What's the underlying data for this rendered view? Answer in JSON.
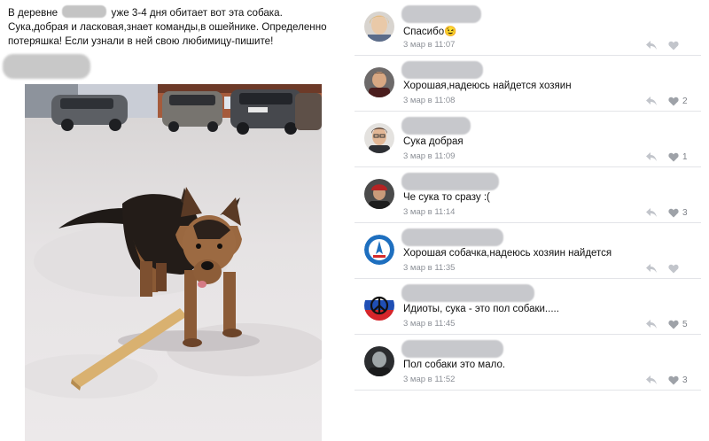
{
  "post": {
    "text_before": "В деревне",
    "text_after": "уже 3-4 дня обитает вот эта собака. Сука,добрая и ласковая,знает команды,в ошейнике. Определенно потеряшка! Если узнали в ней свою любимицу-пишите!"
  },
  "comments": [
    {
      "text": "Спасибо😉",
      "date": "3 мар в 11:07",
      "likes": "",
      "avatar": "woman-avatar"
    },
    {
      "text": "Хорошая,надеюсь найдется хозяин",
      "date": "3 мар в 11:08",
      "likes": "2",
      "avatar": "man-avatar"
    },
    {
      "text": "Сука добрая",
      "date": "3 мар в 11:09",
      "likes": "1",
      "avatar": "man-glasses-avatar"
    },
    {
      "text": "Че сука то сразу :(",
      "date": "3 мар в 11:14",
      "likes": "3",
      "avatar": "man-cap-avatar"
    },
    {
      "text": "Хорошая собачка,надеюсь хозяин найдется",
      "date": "3 мар в 11:35",
      "likes": "",
      "avatar": "emblem-avatar"
    },
    {
      "text": "Идиоты, сука - это пол собаки.....",
      "date": "3 мар в 11:45",
      "likes": "5",
      "avatar": "flag-peace-avatar"
    },
    {
      "text": "Пол собаки это мало.",
      "date": "3 мар в 11:52",
      "likes": "3",
      "avatar": "dark-avatar"
    }
  ],
  "colors": {
    "divider": "#ffffff",
    "muted": "#8b8f96",
    "border": "#e3e4e8"
  }
}
